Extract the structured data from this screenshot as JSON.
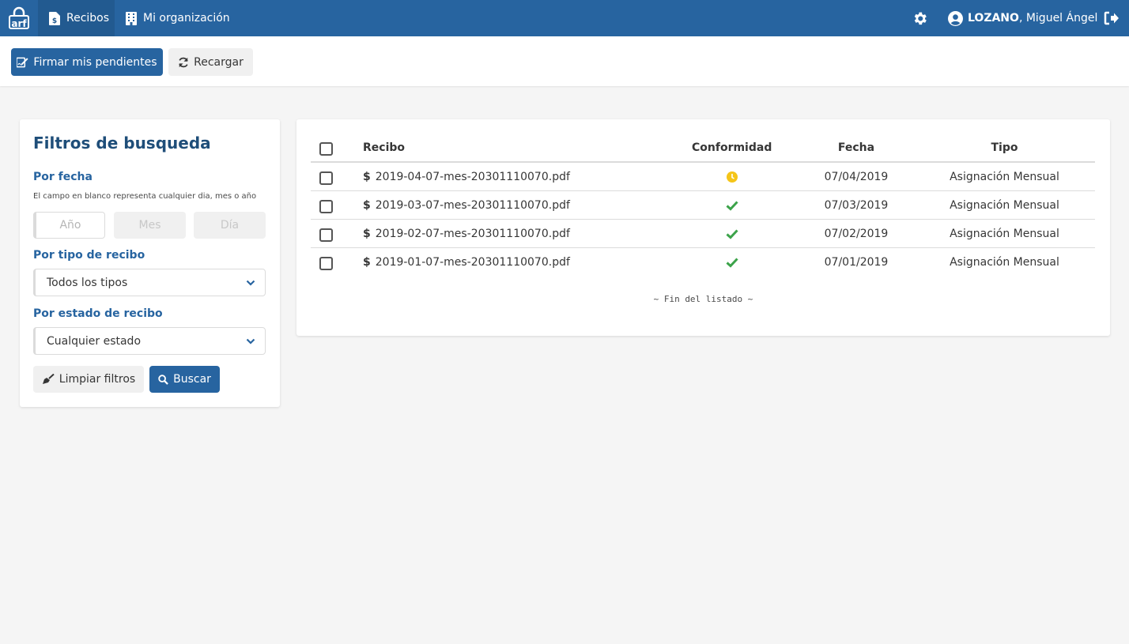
{
  "nav": {
    "logo_text": "arf",
    "tabs": [
      {
        "label": "Recibos",
        "icon": "file-invoice-dollar-icon",
        "active": true
      },
      {
        "label": "Mi organización",
        "icon": "building-icon",
        "active": false
      }
    ],
    "user": {
      "last_name": "LOZANO",
      "first_name": ", Miguel Ángel"
    }
  },
  "toolbar": {
    "sign_label": "Firmar mis pendientes",
    "reload_label": "Recargar"
  },
  "filters": {
    "title": "Filtros de busqueda",
    "date_label": "Por fecha",
    "date_help": "El campo en blanco representa cualquier dia, mes o año",
    "year_placeholder": "Año",
    "month_placeholder": "Mes",
    "day_placeholder": "Día",
    "type_label": "Por tipo de recibo",
    "type_value": "Todos los tipos",
    "state_label": "Por estado de recibo",
    "state_value": "Cualquier estado",
    "clear_label": "Limpiar filtros",
    "search_label": "Buscar"
  },
  "table": {
    "columns": {
      "recibo": "Recibo",
      "conformidad": "Conformidad",
      "fecha": "Fecha",
      "tipo": "Tipo"
    },
    "rows": [
      {
        "file": "2019-04-07-mes-20301110070.pdf",
        "status": "pending",
        "date": "07/04/2019",
        "type": "Asignación Mensual"
      },
      {
        "file": "2019-03-07-mes-20301110070.pdf",
        "status": "ok",
        "date": "07/03/2019",
        "type": "Asignación Mensual"
      },
      {
        "file": "2019-02-07-mes-20301110070.pdf",
        "status": "ok",
        "date": "07/02/2019",
        "type": "Asignación Mensual"
      },
      {
        "file": "2019-01-07-mes-20301110070.pdf",
        "status": "ok",
        "date": "07/01/2019",
        "type": "Asignación Mensual"
      }
    ],
    "end_text": "~ Fin del listado ~"
  },
  "colors": {
    "primary": "#2764a0",
    "pending": "#f5c518",
    "ok": "#3ca34a"
  }
}
